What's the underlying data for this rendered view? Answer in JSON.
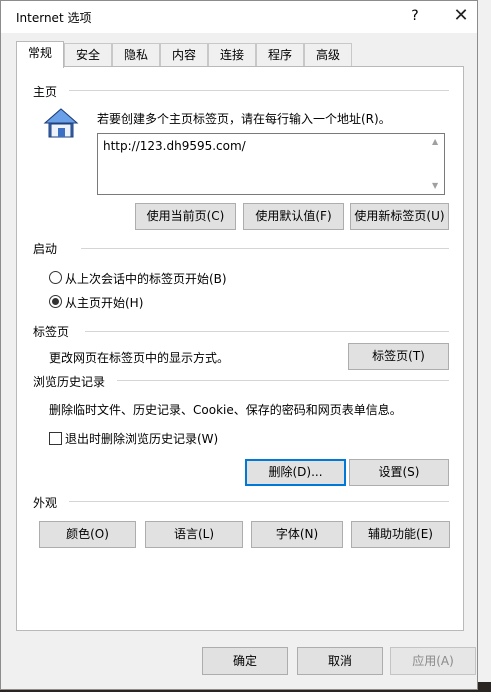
{
  "window": {
    "title": "Internet 选项",
    "help_glyph": "?",
    "close_glyph": "✕"
  },
  "tabs": [
    {
      "label": "常规",
      "active": true
    },
    {
      "label": "安全"
    },
    {
      "label": "隐私"
    },
    {
      "label": "内容"
    },
    {
      "label": "连接"
    },
    {
      "label": "程序"
    },
    {
      "label": "高级"
    }
  ],
  "homepage": {
    "group_label": "主页",
    "description": "若要创建多个主页标签页，请在每行输入一个地址(R)。",
    "url": "http://123.dh9595.com/",
    "buttons": {
      "use_current": "使用当前页(C)",
      "use_default": "使用默认值(F)",
      "use_new_tab": "使用新标签页(U)"
    }
  },
  "startup": {
    "group_label": "启动",
    "options": [
      {
        "label": "从上次会话中的标签页开始(B)",
        "checked": false
      },
      {
        "label": "从主页开始(H)",
        "checked": true
      }
    ]
  },
  "tabs_section": {
    "group_label": "标签页",
    "description": "更改网页在标签页中的显示方式。",
    "button": "标签页(T)"
  },
  "history": {
    "group_label": "浏览历史记录",
    "description": "删除临时文件、历史记录、Cookie、保存的密码和网页表单信息。",
    "checkbox_label": "退出时删除浏览历史记录(W)",
    "checkbox_checked": false,
    "delete_button": "删除(D)...",
    "settings_button": "设置(S)"
  },
  "appearance": {
    "group_label": "外观",
    "buttons": {
      "colors": "颜色(O)",
      "languages": "语言(L)",
      "fonts": "字体(N)",
      "accessibility": "辅助功能(E)"
    }
  },
  "footer": {
    "ok": "确定",
    "cancel": "取消",
    "apply": "应用(A)"
  },
  "colors": {
    "focus_border": "#0078d7",
    "button_bg": "#e1e1e1",
    "icon_blue": "#3a6fc4"
  }
}
